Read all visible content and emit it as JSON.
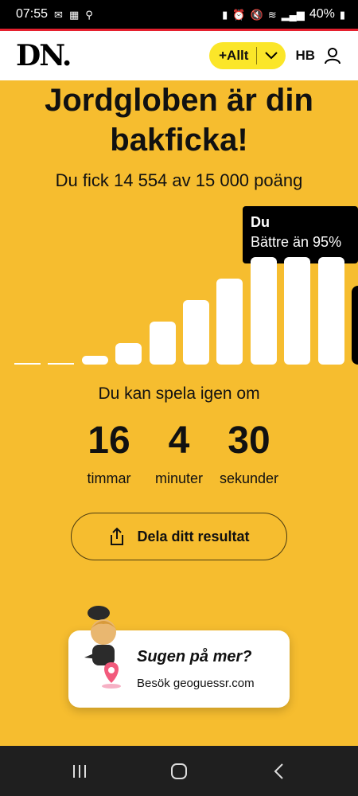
{
  "status_bar": {
    "time": "07:55",
    "battery": "40%"
  },
  "header": {
    "logo": "DN.",
    "allt_label": "+Allt",
    "initials": "HB"
  },
  "result": {
    "title_line1": "Jordgloben är din",
    "title_line2": "bakficka!",
    "score_text": "Du fick 14 554 av 15 000 poäng"
  },
  "distribution": {
    "tooltip_title": "Du",
    "tooltip_sub": "Bättre än 95%",
    "bars": [
      0,
      0,
      8,
      20,
      40,
      60,
      80,
      100,
      100,
      100,
      73
    ],
    "highlight_index": 10
  },
  "countdown": {
    "label": "Du kan spela igen om",
    "hours": "16",
    "hours_label": "timmar",
    "minutes": "4",
    "minutes_label": "minuter",
    "seconds": "30",
    "seconds_label": "sekunder"
  },
  "share": {
    "label": "Dela ditt resultat"
  },
  "promo": {
    "title": "Sugen på mer?",
    "subtitle": "Besök geoguessr.com"
  },
  "colors": {
    "background": "#f6bd2f",
    "accent": "#fbe629",
    "brand_red": "#e5202e"
  }
}
